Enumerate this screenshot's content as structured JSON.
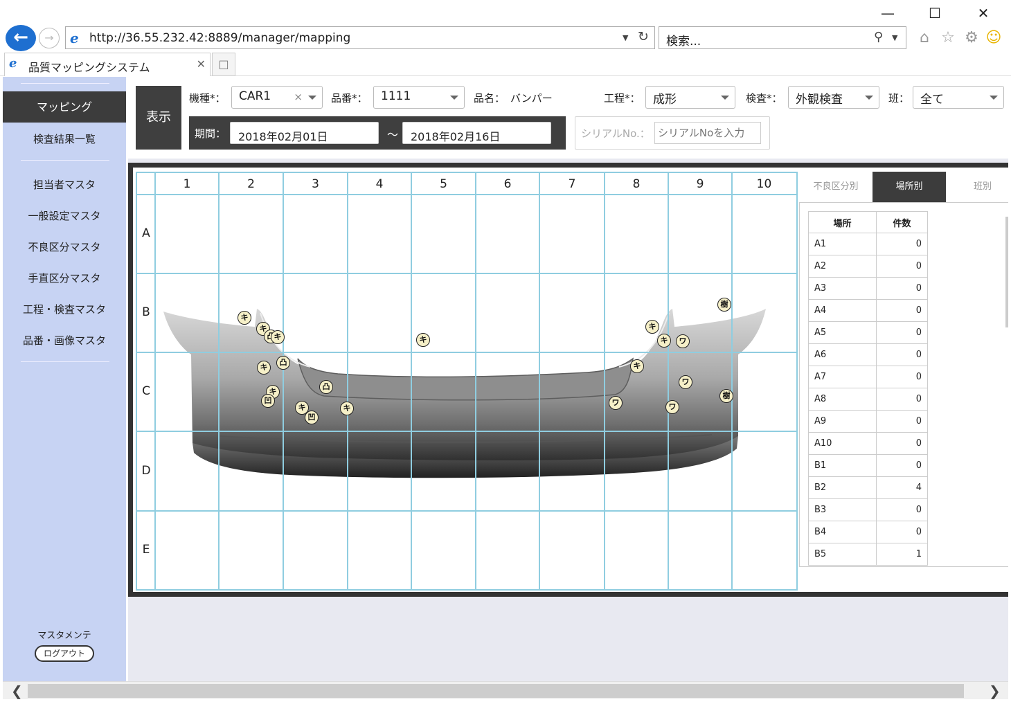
{
  "browser": {
    "url": "http://36.55.232.42:8889/manager/mapping",
    "search_placeholder": "検索...",
    "tab_title": "品質マッピングシステム"
  },
  "sidebar": {
    "active": "マッピング",
    "items": [
      "検査結果一覧",
      "担当者マスタ",
      "一般設定マスタ",
      "不良区分マスタ",
      "手直区分マスタ",
      "工程・検査マスタ",
      "品番・画像マスタ"
    ],
    "bottom_label": "マスタメンテ",
    "logout_label": "ログアウト"
  },
  "filters": {
    "show_button": "表示",
    "model_label": "機種*：",
    "model_value": "CAR1",
    "part_no_label": "品番*：",
    "part_no_value": "1111",
    "part_name_label": "品名：",
    "part_name_value": "バンパー",
    "process_label": "工程*：",
    "process_value": "成形",
    "inspection_label": "検査*：",
    "inspection_value": "外観検査",
    "shift_label": "班：",
    "shift_value": "全て",
    "period_label": "期間：",
    "date_from": "2018年02月01日",
    "tilde": "～",
    "date_to": "2018年02月16日",
    "serial_label": "シリアルNo.：",
    "serial_placeholder": "シリアルNoを入力"
  },
  "grid": {
    "columns": [
      "1",
      "2",
      "3",
      "4",
      "5",
      "6",
      "7",
      "8",
      "9",
      "10"
    ],
    "rows": [
      "A",
      "B",
      "C",
      "D",
      "E"
    ]
  },
  "markers": [
    {
      "label": "キ"
    },
    {
      "label": "キ"
    },
    {
      "label": "凸"
    },
    {
      "label": "キ"
    },
    {
      "label": "キ"
    },
    {
      "label": "凸"
    },
    {
      "label": "キ"
    },
    {
      "label": "凹"
    },
    {
      "label": "凸"
    },
    {
      "label": "キ"
    },
    {
      "label": "凹"
    },
    {
      "label": "キ"
    },
    {
      "label": "キ"
    },
    {
      "label": "キ"
    },
    {
      "label": "キ"
    },
    {
      "label": "ワ"
    },
    {
      "label": "樹"
    },
    {
      "label": "キ"
    },
    {
      "label": "ワ"
    },
    {
      "label": "ワ"
    },
    {
      "label": "ワ"
    },
    {
      "label": "樹"
    }
  ],
  "side_tabs": [
    "不良区分別",
    "場所別",
    "班別"
  ],
  "active_side_tab": "場所別",
  "table": {
    "headers": [
      "場所",
      "件数"
    ],
    "rows": [
      [
        "A1",
        "0"
      ],
      [
        "A2",
        "0"
      ],
      [
        "A3",
        "0"
      ],
      [
        "A4",
        "0"
      ],
      [
        "A5",
        "0"
      ],
      [
        "A6",
        "0"
      ],
      [
        "A7",
        "0"
      ],
      [
        "A8",
        "0"
      ],
      [
        "A9",
        "0"
      ],
      [
        "A10",
        "0"
      ],
      [
        "B1",
        "0"
      ],
      [
        "B2",
        "4"
      ],
      [
        "B3",
        "0"
      ],
      [
        "B4",
        "0"
      ],
      [
        "B5",
        "1"
      ]
    ]
  }
}
